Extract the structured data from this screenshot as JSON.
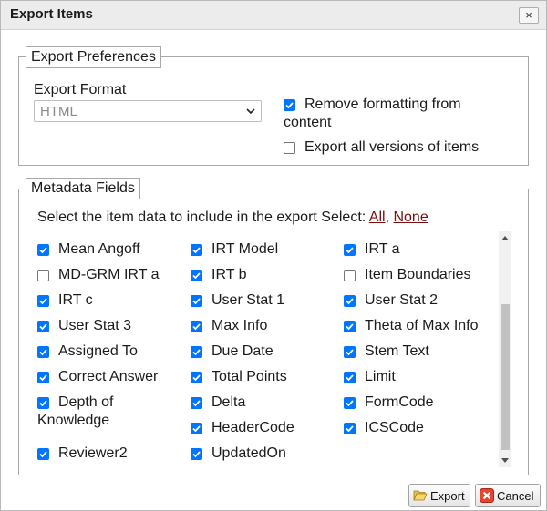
{
  "dialog": {
    "title": "Export Items",
    "close_symbol": "×"
  },
  "prefs": {
    "legend": "Export Preferences",
    "format_label": "Export Format",
    "format_value": "HTML",
    "remove_formatting": {
      "label_line1": "Remove formatting from",
      "label_line2": "content",
      "checked": true
    },
    "export_all_versions": {
      "label": "Export all versions of items",
      "checked": false
    }
  },
  "metadata": {
    "legend": "Metadata Fields",
    "instruction": "Select the item data to include in the export Select:",
    "select_all": "All,",
    "select_none": "None",
    "fields": [
      {
        "label": "Mean Angoff",
        "checked": true
      },
      {
        "label": "IRT Model",
        "checked": true
      },
      {
        "label": "IRT a",
        "checked": true
      },
      {
        "label": "MD-GRM IRT a",
        "checked": false
      },
      {
        "label": "IRT b",
        "checked": true
      },
      {
        "label": "Item Boundaries",
        "checked": false
      },
      {
        "label": "IRT c",
        "checked": true
      },
      {
        "label": "User Stat 1",
        "checked": true
      },
      {
        "label": "User Stat 2",
        "checked": true
      },
      {
        "label": "User Stat 3",
        "checked": true
      },
      {
        "label": "Max Info",
        "checked": true
      },
      {
        "label": "Theta of Max Info",
        "checked": true
      },
      {
        "label": "Assigned To",
        "checked": true
      },
      {
        "label": "Due Date",
        "checked": true
      },
      {
        "label": "Stem Text",
        "checked": true
      },
      {
        "label": "Correct Answer",
        "checked": true
      },
      {
        "label": "Total Points",
        "checked": true
      },
      {
        "label": "Limit",
        "checked": true
      },
      {
        "label": "Depth of Knowledge",
        "line1": "Depth of",
        "line2": "Knowledge",
        "checked": true
      },
      {
        "label": "Delta",
        "checked": true
      },
      {
        "label": "FormCode",
        "checked": true
      },
      {
        "label": "",
        "checked": null
      },
      {
        "label": "HeaderCode",
        "checked": true
      },
      {
        "label": "ICSCode",
        "checked": true
      },
      {
        "label": "Reviewer2",
        "checked": true
      },
      {
        "label": "UpdatedOn",
        "checked": true
      }
    ]
  },
  "buttons": {
    "export": "Export",
    "cancel": "Cancel"
  }
}
